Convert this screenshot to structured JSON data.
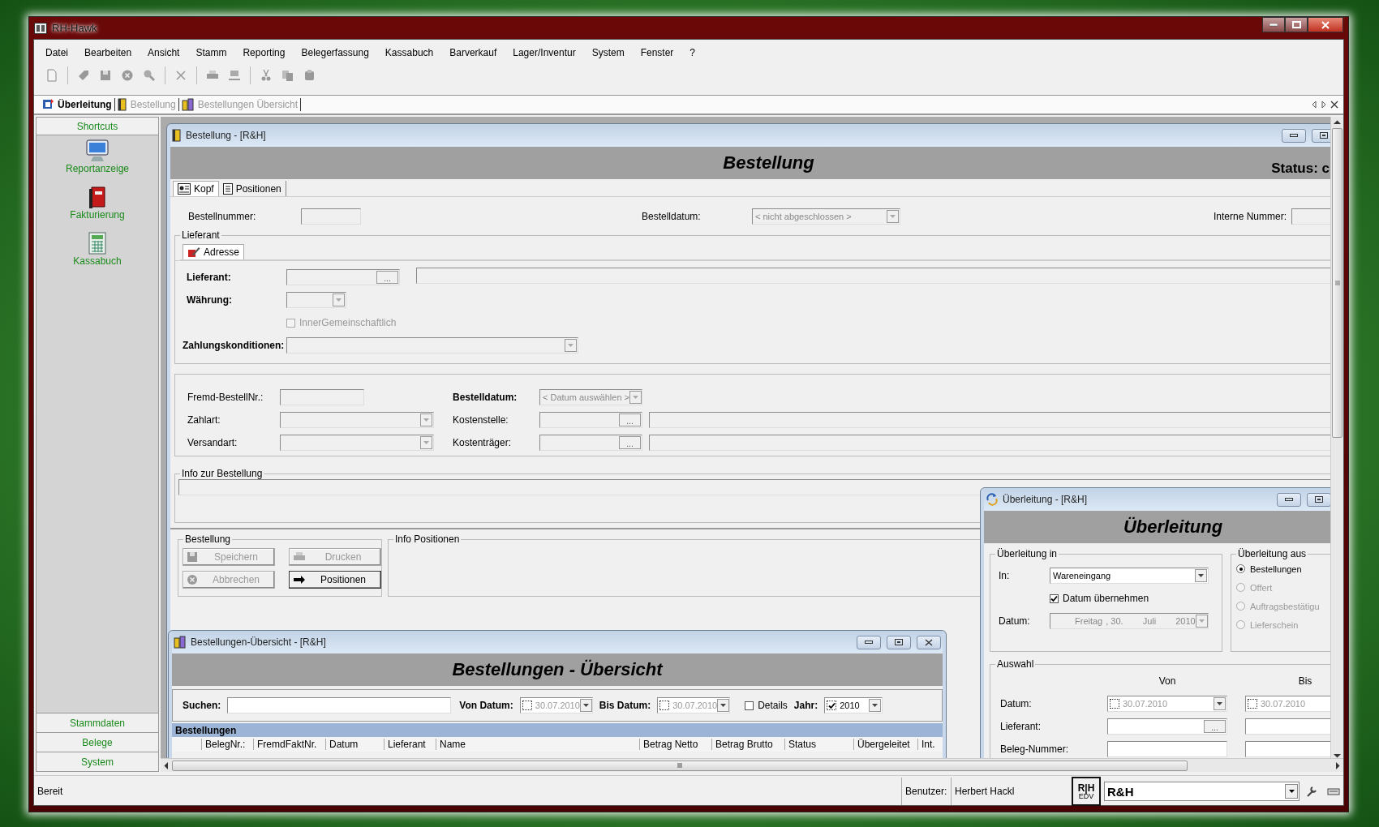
{
  "window": {
    "title": "RH-Hawk"
  },
  "menu": [
    "Datei",
    "Bearbeiten",
    "Ansicht",
    "Stamm",
    "Reporting",
    "Belegerfassung",
    "Kassabuch",
    "Barverkauf",
    "Lager/Inventur",
    "System",
    "Fenster",
    "?"
  ],
  "doc_tabs": [
    {
      "label": "Überleitung",
      "kind": "transfer",
      "selected": true
    },
    {
      "label": "Bestellung",
      "kind": "book",
      "selected": false
    },
    {
      "label": "Bestellungen Übersicht",
      "kind": "books",
      "selected": false
    }
  ],
  "sidebar": {
    "header": "Shortcuts",
    "shortcuts": [
      {
        "label": "Reportanzeige",
        "kind": "monitor"
      },
      {
        "label": "Fakturierung",
        "kind": "book"
      },
      {
        "label": "Kassabuch",
        "kind": "calculator"
      }
    ],
    "sections": [
      "Stammdaten",
      "Belege",
      "System"
    ]
  },
  "bestellung": {
    "title": "Bestellung - [R&H]",
    "heading": "Bestellung",
    "status": "Status: c",
    "tabs": [
      {
        "label": "Kopf",
        "kind": "card",
        "selected": true
      },
      {
        "label": "Positionen",
        "kind": "list",
        "selected": false
      }
    ],
    "row": [
      {
        "label": "Bestellnummer:",
        "field": {
          "kind": "text",
          "disabled": true
        }
      },
      {
        "label": "Bestelldatum:",
        "field": {
          "kind": "combo",
          "value": "< nicht abgeschlossen >",
          "disabled": true
        }
      },
      {
        "label": "Interne Nummer:",
        "field": {
          "kind": "text",
          "disabled": true
        }
      }
    ],
    "lieferant": {
      "legend": "Lieferant",
      "tab": {
        "label": "Adresse",
        "selected": true
      },
      "fields": [
        {
          "label": "Lieferant:",
          "required": true,
          "field": {
            "kind": "lookup",
            "button": "...",
            "disabled": true
          }
        },
        {
          "label": "Währung:",
          "required": true,
          "field": {
            "kind": "combo",
            "disabled": true
          }
        }
      ],
      "inner": {
        "label": "InnerGemeinschaftlich",
        "checked": false,
        "disabled": true
      },
      "zahlung": {
        "label": "Zahlungskonditionen:",
        "required": true,
        "field": {
          "kind": "combo",
          "disabled": true
        }
      },
      "adresse": {
        "kind": "area",
        "disabled": true
      }
    },
    "details": {
      "left": [
        {
          "label": "Fremd-BestellNr.:",
          "required": false,
          "field": {
            "kind": "text",
            "disabled": true
          }
        },
        {
          "label": "Zahlart:",
          "required": false,
          "field": {
            "kind": "combo",
            "disabled": true
          }
        },
        {
          "label": "Versandart:",
          "required": false,
          "field": {
            "kind": "combo",
            "disabled": true
          }
        }
      ],
      "right": [
        {
          "label": "Bestelldatum:",
          "required": true,
          "field": {
            "kind": "combo",
            "value": "< Datum auswählen >",
            "disabled": true
          }
        },
        {
          "label": "Kostenstelle:",
          "required": false,
          "field": {
            "kind": "lookup",
            "button": "...",
            "disabled": true
          },
          "extra": {
            "kind": "text",
            "disabled": true
          }
        },
        {
          "label": "Kostenträger:",
          "required": false,
          "field": {
            "kind": "lookup",
            "button": "...",
            "disabled": true
          },
          "extra": {
            "kind": "text",
            "disabled": true
          }
        }
      ]
    },
    "info": {
      "legend": "Info zur Bestellung",
      "field": {
        "kind": "area",
        "disabled": true
      }
    },
    "actions": {
      "legend": "Bestellung",
      "buttons": [
        {
          "label": "Speichern",
          "kind": "save",
          "disabled": true
        },
        {
          "label": "Drucken",
          "kind": "print",
          "disabled": true
        },
        {
          "label": "Abbrechen",
          "kind": "cancel",
          "disabled": true
        },
        {
          "label": "Positionen",
          "kind": "arrow",
          "disabled": false
        }
      ]
    },
    "info_positionen": {
      "legend": "Info Positionen"
    }
  },
  "ueberleitung": {
    "title": "Überleitung - [R&H]",
    "heading": "Überleitung",
    "in": {
      "legend": "Überleitung in",
      "in": {
        "label": "In:",
        "field": {
          "kind": "combo",
          "value": "Wareneingang",
          "disabled": false
        }
      },
      "uebernehmen": {
        "label": "Datum übernehmen",
        "checked": true,
        "disabled": false
      },
      "datum": {
        "label": "Datum:",
        "field": {
          "kind": "longdate",
          "parts": [
            "Freitag",
            ", 30.",
            "Juli",
            "2010"
          ],
          "disabled": true
        }
      }
    },
    "aus": {
      "legend": "Überleitung aus",
      "options": [
        {
          "label": "Bestellungen",
          "selected": true,
          "disabled": false
        },
        {
          "label": "Offert",
          "selected": false,
          "disabled": true
        },
        {
          "label": "Auftragsbestätigu",
          "selected": false,
          "disabled": true
        },
        {
          "label": "Lieferschein",
          "selected": false,
          "disabled": true
        }
      ]
    },
    "auswahl": {
      "legend": "Auswahl",
      "columns": [
        "Von",
        "Bis"
      ],
      "rows": [
        {
          "label": "Datum:",
          "fields": [
            {
              "kind": "date",
              "checked": false,
              "value": "30.07.2010",
              "disabled": false
            },
            {
              "kind": "date",
              "checked": false,
              "value": "30.07.2010",
              "disabled": false
            }
          ]
        },
        {
          "label": "Lieferant:",
          "fields": [
            {
              "kind": "lookup",
              "button": "...",
              "disabled": false
            },
            {
              "kind": "lookup",
              "disabled": false
            }
          ]
        },
        {
          "label": "Beleg-Nummer:",
          "fields": [
            {
              "kind": "text",
              "disabled": false
            },
            {
              "kind": "text",
              "disabled": false
            }
          ]
        }
      ]
    }
  },
  "uebersicht": {
    "title": "Bestellungen-Übersicht - [R&H]",
    "heading": "Bestellungen - Übersicht",
    "filters": [
      {
        "kind": "field",
        "label": "Suchen:",
        "field": {
          "kind": "text",
          "disabled": false
        }
      },
      {
        "kind": "field",
        "label": "Von Datum:",
        "field": {
          "kind": "date",
          "checked": false,
          "value": "30.07.2010",
          "disabled": false
        }
      },
      {
        "kind": "field",
        "label": "Bis Datum:",
        "field": {
          "kind": "date",
          "checked": false,
          "value": "30.07.2010",
          "disabled": false
        }
      },
      {
        "kind": "checkbox",
        "label": "Details",
        "checked": false
      },
      {
        "kind": "field",
        "label": "Jahr:",
        "field": {
          "kind": "date",
          "checked": true,
          "value": "2010",
          "disabled": false
        }
      }
    ],
    "grid": {
      "title": "Bestellungen",
      "columns": [
        "BelegNr.:",
        "FremdFaktNr.",
        "Datum",
        "Lieferant",
        "Name",
        "Betrag Netto",
        "Betrag Brutto",
        "Status",
        "Übergeleitet",
        "Int."
      ]
    }
  },
  "status_bar": {
    "text": "Bereit",
    "user_label": "Benutzer:",
    "user": "Herbert Hackl",
    "logo": [
      "R|H",
      "EDV"
    ],
    "company": "R&H"
  }
}
